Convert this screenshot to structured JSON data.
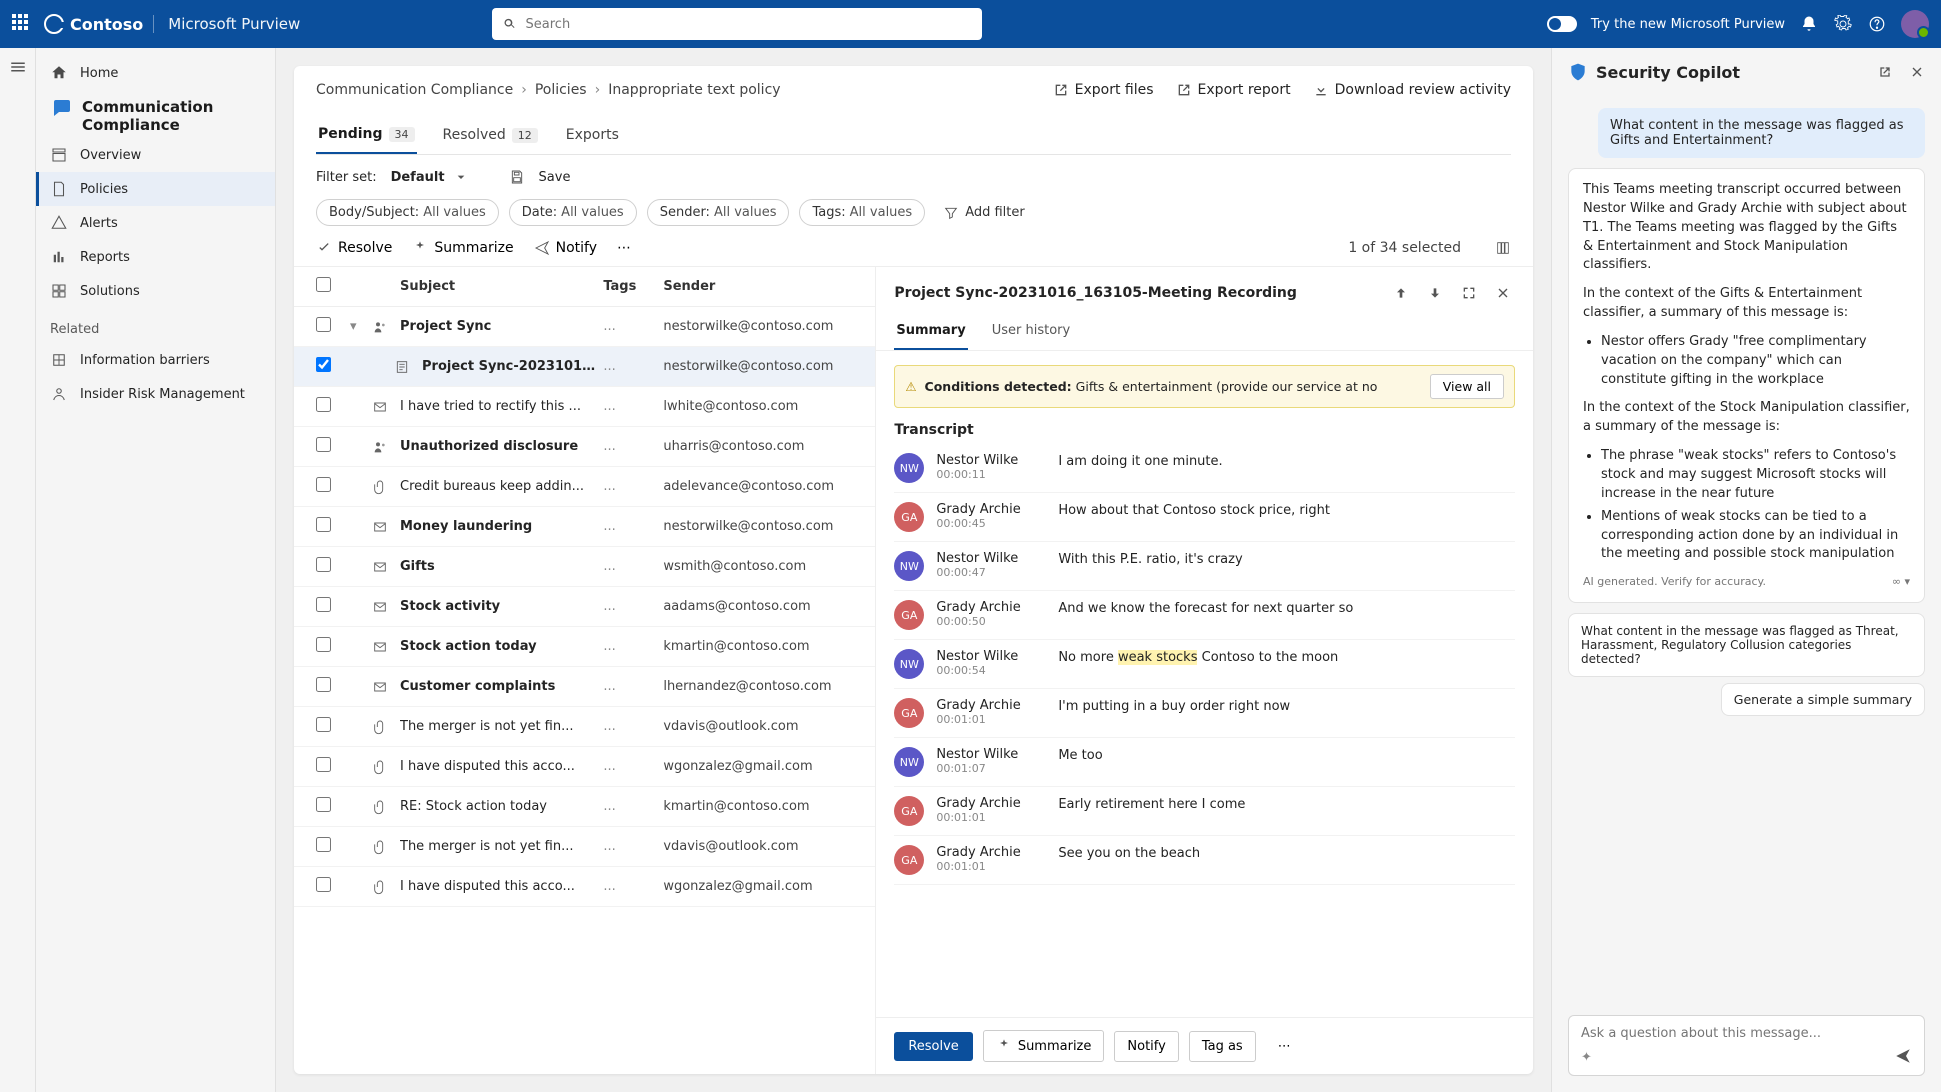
{
  "header": {
    "brand": "Contoso",
    "product": "Microsoft Purview",
    "search_placeholder": "Search",
    "try_label": "Try the new Microsoft Purview"
  },
  "leftnav": {
    "home": "Home",
    "group_title": "Communication Compliance",
    "items": [
      "Overview",
      "Policies",
      "Alerts",
      "Reports",
      "Solutions"
    ],
    "related_header": "Related",
    "related": [
      "Information barriers",
      "Insider Risk Management"
    ]
  },
  "breadcrumb": [
    "Communication Compliance",
    "Policies",
    "Inappropriate text policy"
  ],
  "head_actions": {
    "export_files": "Export files",
    "export_report": "Export report",
    "download_review": "Download review activity"
  },
  "tabs": [
    {
      "label": "Pending",
      "badge": "34",
      "active": true
    },
    {
      "label": "Resolved",
      "badge": "12"
    },
    {
      "label": "Exports"
    }
  ],
  "filter": {
    "set_label": "Filter set:",
    "set_value": "Default",
    "save": "Save",
    "add_filter": "Add filter"
  },
  "filter_chips": [
    {
      "k": "Body/Subject:",
      "v": "All values"
    },
    {
      "k": "Date:",
      "v": "All values"
    },
    {
      "k": "Sender:",
      "v": "All values"
    },
    {
      "k": "Tags:",
      "v": "All values"
    }
  ],
  "actions": {
    "resolve": "Resolve",
    "summarize": "Summarize",
    "notify": "Notify",
    "selected": "1 of 34 selected"
  },
  "list": {
    "headers": {
      "subject": "Subject",
      "tags": "Tags",
      "sender": "Sender"
    },
    "rows": [
      {
        "icon": "teams",
        "subject": "Project Sync",
        "sender": "nestorwilke@contoso.com",
        "bold": true,
        "caret": true
      },
      {
        "icon": "transcript",
        "subject": "Project Sync-2023101...",
        "sender": "nestorwilke@contoso.com",
        "bold": true,
        "child": true,
        "checked": true,
        "selected": true
      },
      {
        "icon": "mail",
        "subject": "I have tried to rectify this ...",
        "sender": "lwhite@contoso.com"
      },
      {
        "icon": "teams",
        "subject": "Unauthorized disclosure",
        "sender": "uharris@contoso.com",
        "bold": true
      },
      {
        "icon": "attach",
        "subject": "Credit bureaus keep addin...",
        "sender": "adelevance@contoso.com"
      },
      {
        "icon": "mail",
        "subject": "Money laundering",
        "sender": "nestorwilke@contoso.com",
        "bold": true
      },
      {
        "icon": "mail",
        "subject": "Gifts",
        "sender": "wsmith@contoso.com",
        "bold": true
      },
      {
        "icon": "mail",
        "subject": "Stock activity",
        "sender": "aadams@contoso.com",
        "bold": true
      },
      {
        "icon": "mail",
        "subject": "Stock action today",
        "sender": "kmartin@contoso.com",
        "bold": true
      },
      {
        "icon": "mail",
        "subject": "Customer complaints",
        "sender": "lhernandez@contoso.com",
        "bold": true
      },
      {
        "icon": "attach",
        "subject": "The merger is not yet fin...",
        "sender": "vdavis@outlook.com"
      },
      {
        "icon": "attach",
        "subject": "I have disputed this acco...",
        "sender": "wgonzalez@gmail.com"
      },
      {
        "icon": "attach",
        "subject": "RE: Stock action today",
        "sender": "kmartin@contoso.com"
      },
      {
        "icon": "attach",
        "subject": "The merger is not yet fin...",
        "sender": "vdavis@outlook.com"
      },
      {
        "icon": "attach",
        "subject": "I have disputed this acco...",
        "sender": "wgonzalez@gmail.com"
      }
    ]
  },
  "detail": {
    "title": "Project Sync-20231016_163105-Meeting Recording",
    "tabs": [
      "Summary",
      "User history"
    ],
    "cond_label": "Conditions detected:",
    "cond_text": "Gifts & entertainment (provide our service at no",
    "view_all": "View all",
    "transcript_label": "Transcript",
    "transcript": [
      {
        "who": "NW",
        "name": "Nestor Wilke",
        "time": "00:00:11",
        "text": "I am doing it one minute."
      },
      {
        "who": "GA",
        "name": "Grady Archie",
        "time": "00:00:45",
        "text": "How about that Contoso stock price, right"
      },
      {
        "who": "NW",
        "name": "Nestor Wilke",
        "time": "00:00:47",
        "text": "With this P.E. ratio, it's crazy"
      },
      {
        "who": "GA",
        "name": "Grady Archie",
        "time": "00:00:50",
        "text": "And we know the forecast for next quarter so"
      },
      {
        "who": "NW",
        "name": "Nestor Wilke",
        "time": "00:00:54",
        "text_pre": "No more ",
        "hl": "weak stocks",
        "text_post": " Contoso to the moon"
      },
      {
        "who": "GA",
        "name": "Grady Archie",
        "time": "00:01:01",
        "text": "I'm putting in a buy order right now"
      },
      {
        "who": "NW",
        "name": "Nestor Wilke",
        "time": "00:01:07",
        "text": "Me too"
      },
      {
        "who": "GA",
        "name": "Grady Archie",
        "time": "00:01:01",
        "text": "Early retirement here I come"
      },
      {
        "who": "GA",
        "name": "Grady Archie",
        "time": "00:01:01",
        "text": "See you on the beach"
      }
    ],
    "actions": {
      "resolve": "Resolve",
      "summarize": "Summarize",
      "notify": "Notify",
      "tag_as": "Tag as"
    }
  },
  "copilot": {
    "title": "Security Copilot",
    "user1": "What content in the message was flagged as Gifts and Entertainment?",
    "ai_p1": "This Teams meeting transcript occurred between Nestor Wilke and Grady Archie with subject about T1. The Teams meeting was flagged by the Gifts & Entertainment  and Stock Manipulation classifiers.",
    "ai_p2": "In the context of the Gifts & Entertainment classifier, a summary of this message is:",
    "ai_b1": "Nestor offers Grady \"free complimentary vacation on the company\" which can constitute gifting in the workplace",
    "ai_p3": "In the context of the Stock Manipulation classifier, a summary of the message is:",
    "ai_b2": "The phrase \"weak stocks\" refers to Contoso's stock and may suggest Microsoft stocks will increase in the near future",
    "ai_b3": "Mentions of weak stocks can be tied to a corresponding action done by an individual in the meeting and possible stock manipulation",
    "ai_foot": "AI generated. Verify for accuracy.",
    "user2": "What content in the message was flagged as Threat, Harassment, Regulatory Collusion categories detected?",
    "pill": "Generate a simple summary",
    "input_placeholder": "Ask a question about this message..."
  }
}
